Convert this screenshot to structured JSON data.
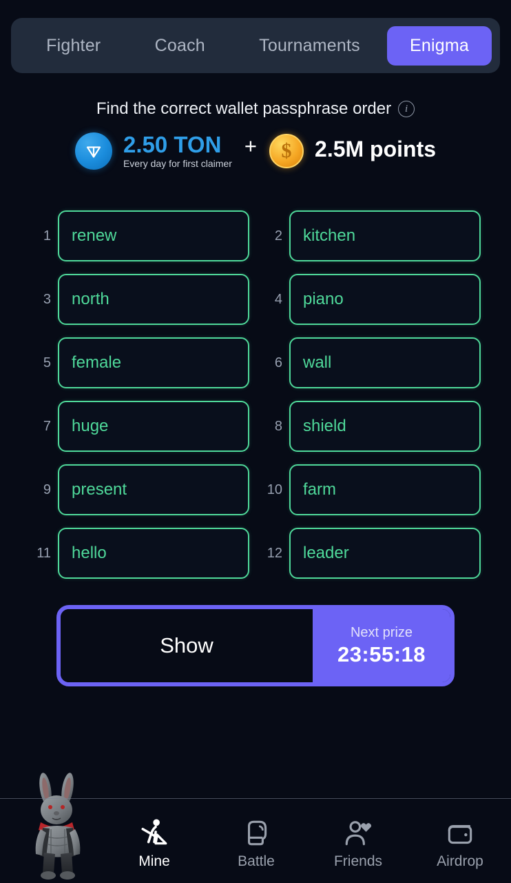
{
  "tabs": [
    {
      "label": "Fighter",
      "active": false
    },
    {
      "label": "Coach",
      "active": false
    },
    {
      "label": "Tournaments",
      "active": false
    },
    {
      "label": "Enigma",
      "active": true
    }
  ],
  "header": {
    "headline": "Find the correct wallet passphrase order",
    "info_icon": "info-icon"
  },
  "prize": {
    "ton_icon": "ton-coin-icon",
    "ton_amount": "2.50 TON",
    "ton_subtitle": "Every day for first claimer",
    "plus": "+",
    "coin_icon": "dollar-coin-icon",
    "coin_symbol": "$",
    "points_amount": "2.5M points"
  },
  "grid": {
    "words": [
      {
        "num": "1",
        "word": "renew"
      },
      {
        "num": "2",
        "word": "kitchen"
      },
      {
        "num": "3",
        "word": "north"
      },
      {
        "num": "4",
        "word": "piano"
      },
      {
        "num": "5",
        "word": "female"
      },
      {
        "num": "6",
        "word": "wall"
      },
      {
        "num": "7",
        "word": "huge"
      },
      {
        "num": "8",
        "word": "shield"
      },
      {
        "num": "9",
        "word": "present"
      },
      {
        "num": "10",
        "word": "farm"
      },
      {
        "num": "11",
        "word": "hello"
      },
      {
        "num": "12",
        "word": "leader"
      }
    ]
  },
  "action": {
    "show_label": "Show",
    "next_prize_label": "Next prize",
    "next_prize_timer": "23:55:18"
  },
  "mascot": {
    "name": "rabbit-mascot"
  },
  "bottom_nav": [
    {
      "label": "Mine",
      "icon": "miner-pickaxe-icon",
      "active": true
    },
    {
      "label": "Battle",
      "icon": "boxing-glove-icon",
      "active": false
    },
    {
      "label": "Friends",
      "icon": "person-heart-icon",
      "active": false
    },
    {
      "label": "Airdrop",
      "icon": "wallet-icon",
      "active": false
    }
  ],
  "colors": {
    "background": "#070b16",
    "tabbar_bg": "#222c3c",
    "accent_purple": "#6c63f5",
    "word_green": "#4fd99a",
    "ton_blue": "#2f9ee8",
    "coin_orange": "#f5a623",
    "muted_text": "#9aa1ad"
  }
}
